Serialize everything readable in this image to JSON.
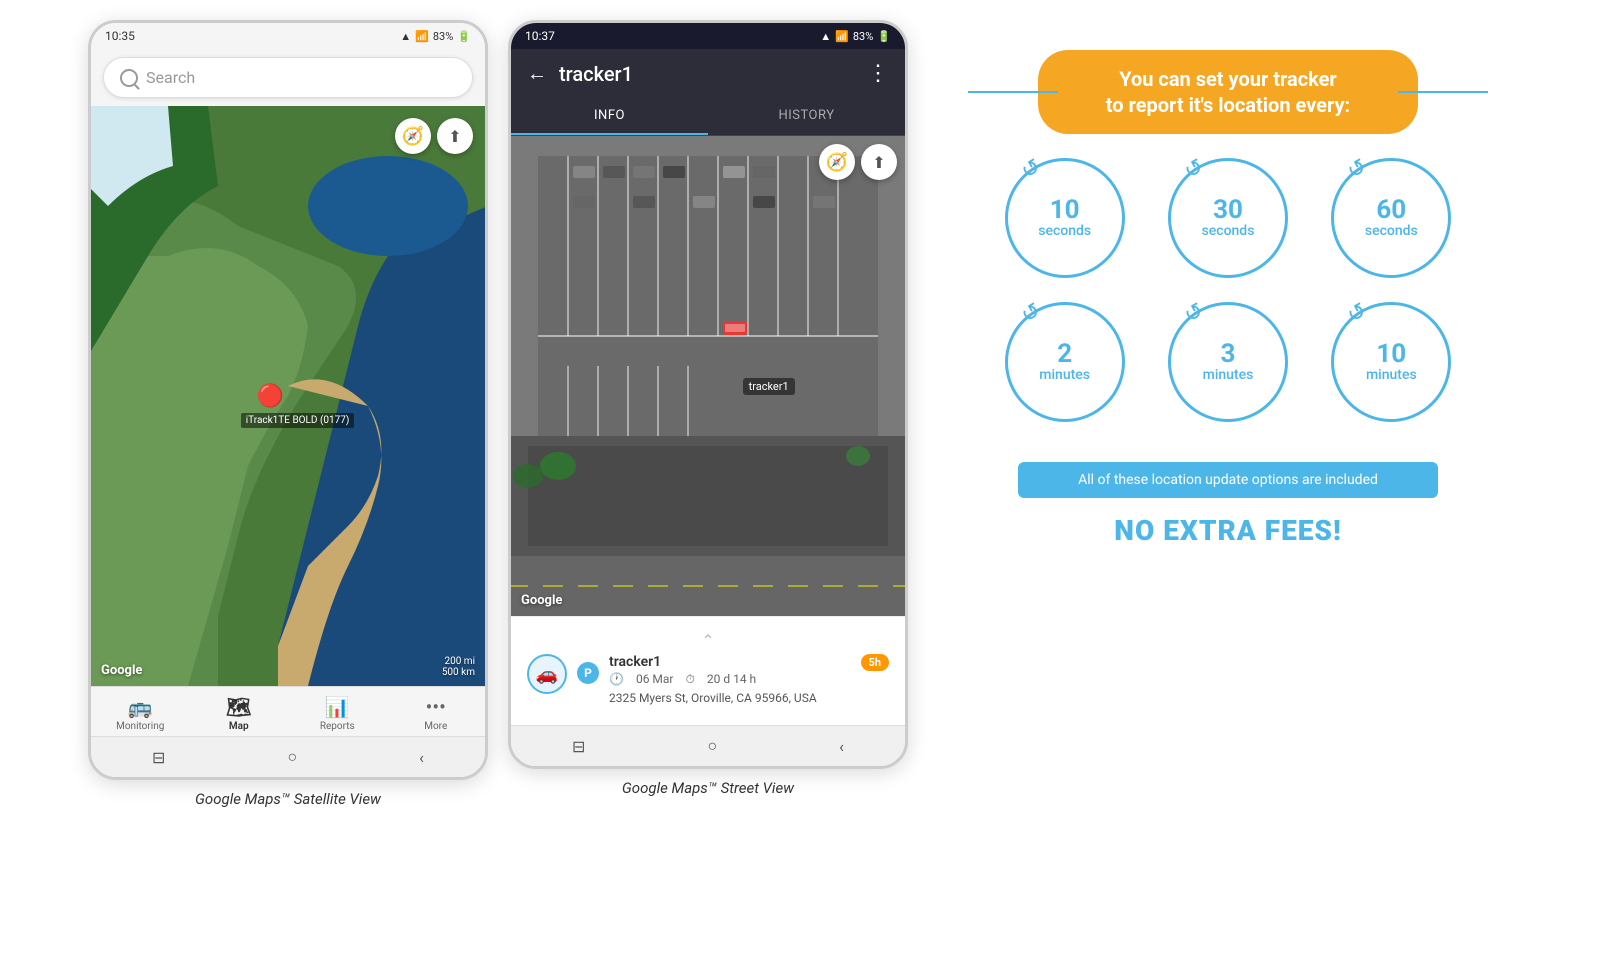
{
  "phone1": {
    "statusBar": {
      "time": "10:35",
      "battery": "83%",
      "signal": "▲▲▲",
      "wifi": "WiFi"
    },
    "search": {
      "placeholder": "Search"
    },
    "tracker": {
      "label": "iTrack1TE BOLD (0177)"
    },
    "googleLogo": "Google",
    "scale": "200 mi\n500 km",
    "nav": {
      "items": [
        "Monitoring",
        "Map",
        "Reports",
        "More"
      ],
      "activeIndex": 1
    },
    "caption": "Google Maps™ Satellite View"
  },
  "phone2": {
    "statusBar": {
      "time": "10:37",
      "battery": "83%"
    },
    "header": {
      "title": "tracker1",
      "backIcon": "←",
      "menuIcon": "⋮"
    },
    "tabs": [
      "INFO",
      "HISTORY"
    ],
    "activeTab": "INFO",
    "googleLogo": "Google",
    "trackerInfo": {
      "name": "tracker1",
      "date": "06 Mar",
      "duration": "20 d 14 h",
      "address": "2325 Myers St, Oroville, CA 95966, USA",
      "timeBadge": "5h",
      "markerLabel": "tracker1"
    },
    "caption": "Google Maps™ Street View"
  },
  "infographic": {
    "headline": "You can set your tracker\nto report it's location every:",
    "circles": [
      {
        "number": "10",
        "unit": "seconds"
      },
      {
        "number": "30",
        "unit": "seconds"
      },
      {
        "number": "60",
        "unit": "seconds"
      },
      {
        "number": "2",
        "unit": "minutes"
      },
      {
        "number": "3",
        "unit": "minutes"
      },
      {
        "number": "10",
        "unit": "minutes"
      }
    ],
    "banner": "All of these location update options are included",
    "noFees": "NO EXTRA FEES!",
    "colors": {
      "orange": "#f5a623",
      "blue": "#4db6e8"
    }
  }
}
